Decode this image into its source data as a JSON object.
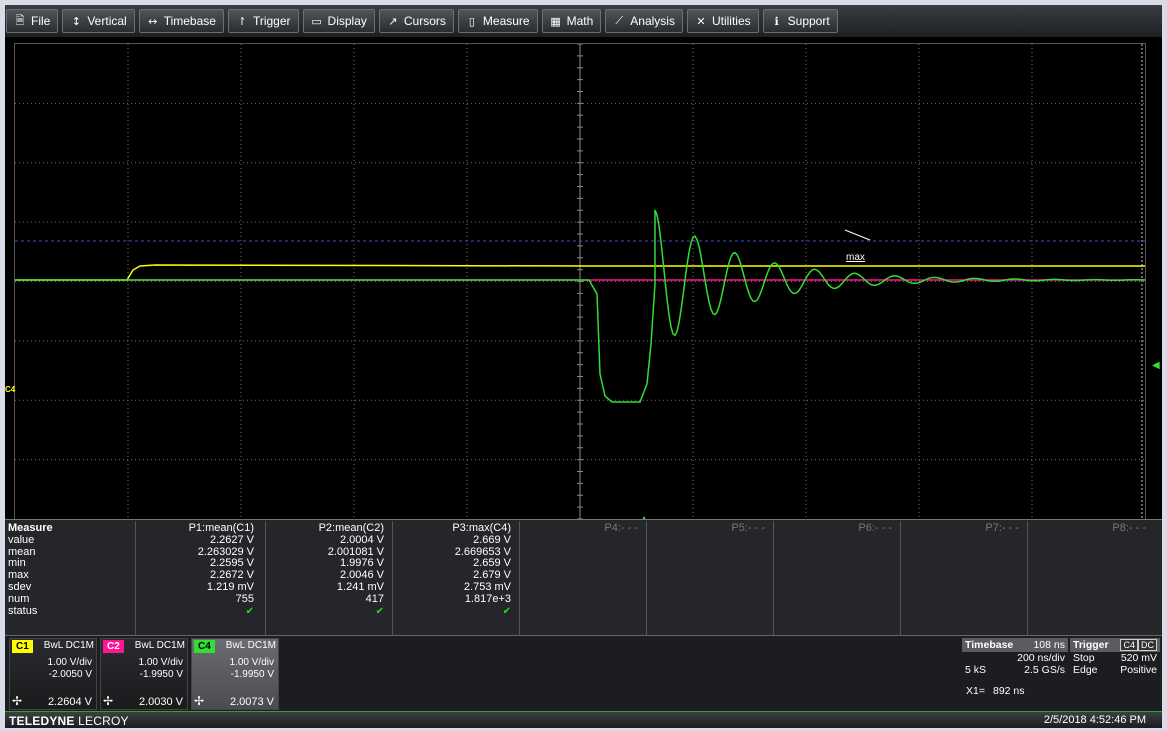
{
  "menu": [
    {
      "label": "File",
      "icon": "file-icon",
      "glyph": "🗎"
    },
    {
      "label": "Vertical",
      "icon": "vertical-icon",
      "glyph": "↕"
    },
    {
      "label": "Timebase",
      "icon": "timebase-icon",
      "glyph": "↔"
    },
    {
      "label": "Trigger",
      "icon": "trigger-icon",
      "glyph": "↾"
    },
    {
      "label": "Display",
      "icon": "display-icon",
      "glyph": "▭"
    },
    {
      "label": "Cursors",
      "icon": "cursors-icon",
      "glyph": "↗"
    },
    {
      "label": "Measure",
      "icon": "measure-icon",
      "glyph": "▯"
    },
    {
      "label": "Math",
      "icon": "math-icon",
      "glyph": "▦"
    },
    {
      "label": "Analysis",
      "icon": "analysis-icon",
      "glyph": "⟋"
    },
    {
      "label": "Utilities",
      "icon": "utilities-icon",
      "glyph": "✕"
    },
    {
      "label": "Support",
      "icon": "support-icon",
      "glyph": "ℹ"
    }
  ],
  "waveform": {
    "channel_marker": "C4",
    "max_label": "max",
    "colors": {
      "c1": "#ffff00",
      "c2": "#ff1493",
      "c4": "#33dd33",
      "max_line": "#3b4bd9",
      "grid": "#707070"
    }
  },
  "measure": {
    "title": "Measure",
    "row_labels": [
      "value",
      "mean",
      "min",
      "max",
      "sdev",
      "num",
      "status"
    ],
    "columns": [
      {
        "header": "P1:mean(C1)",
        "value": "2.2627 V",
        "mean": "2.263029 V",
        "min": "2.2595 V",
        "max": "2.2672 V",
        "sdev": "1.219 mV",
        "num": "755",
        "status": "✔"
      },
      {
        "header": "P2:mean(C2)",
        "value": "2.0004 V",
        "mean": "2.001081 V",
        "min": "1.9976 V",
        "max": "2.0046 V",
        "sdev": "1.241 mV",
        "num": "417",
        "status": "✔"
      },
      {
        "header": "P3:max(C4)",
        "value": "2.669 V",
        "mean": "2.669653 V",
        "min": "2.659 V",
        "max": "2.679 V",
        "sdev": "2.753 mV",
        "num": "1.817e+3",
        "status": "✔"
      },
      {
        "header": "P4:- - -"
      },
      {
        "header": "P5:- - -"
      },
      {
        "header": "P6:- - -"
      },
      {
        "header": "P7:- - -"
      },
      {
        "header": "P8:- - -"
      }
    ]
  },
  "channels": [
    {
      "tag": "C1",
      "tag_color": "#ffff00",
      "tag_text": "#000000",
      "coupling": "BwL DC1M",
      "vdiv": "1.00 V/div",
      "offset": "-2.0050 V",
      "readout": "2.2604 V"
    },
    {
      "tag": "C2",
      "tag_color": "#ff1493",
      "tag_text": "#ffffff",
      "coupling": "BwL DC1M",
      "vdiv": "1.00 V/div",
      "offset": "-1.9950 V",
      "readout": "2.0030 V"
    },
    {
      "tag": "C4",
      "tag_color": "#33dd33",
      "tag_text": "#000000",
      "coupling": "BwL DC1M",
      "vdiv": "1.00 V/div",
      "offset": "-1.9950 V",
      "readout": "2.0073 V"
    }
  ],
  "timebase": {
    "title": "Timebase",
    "delay": "108 ns",
    "rate": "200 ns/div",
    "samples": "5 kS",
    "sample_rate": "2.5 GS/s"
  },
  "trigger": {
    "title": "Trigger",
    "source": "C4",
    "coupling": "DC",
    "mode": "Stop",
    "level": "520 mV",
    "type": "Edge",
    "slope": "Positive"
  },
  "cursor": {
    "label": "X1=",
    "value": "892 ns"
  },
  "status": {
    "brand_bold": "TELEDYNE",
    "brand_light": " LECROY",
    "datetime": "2/5/2018 4:52:46 PM"
  }
}
